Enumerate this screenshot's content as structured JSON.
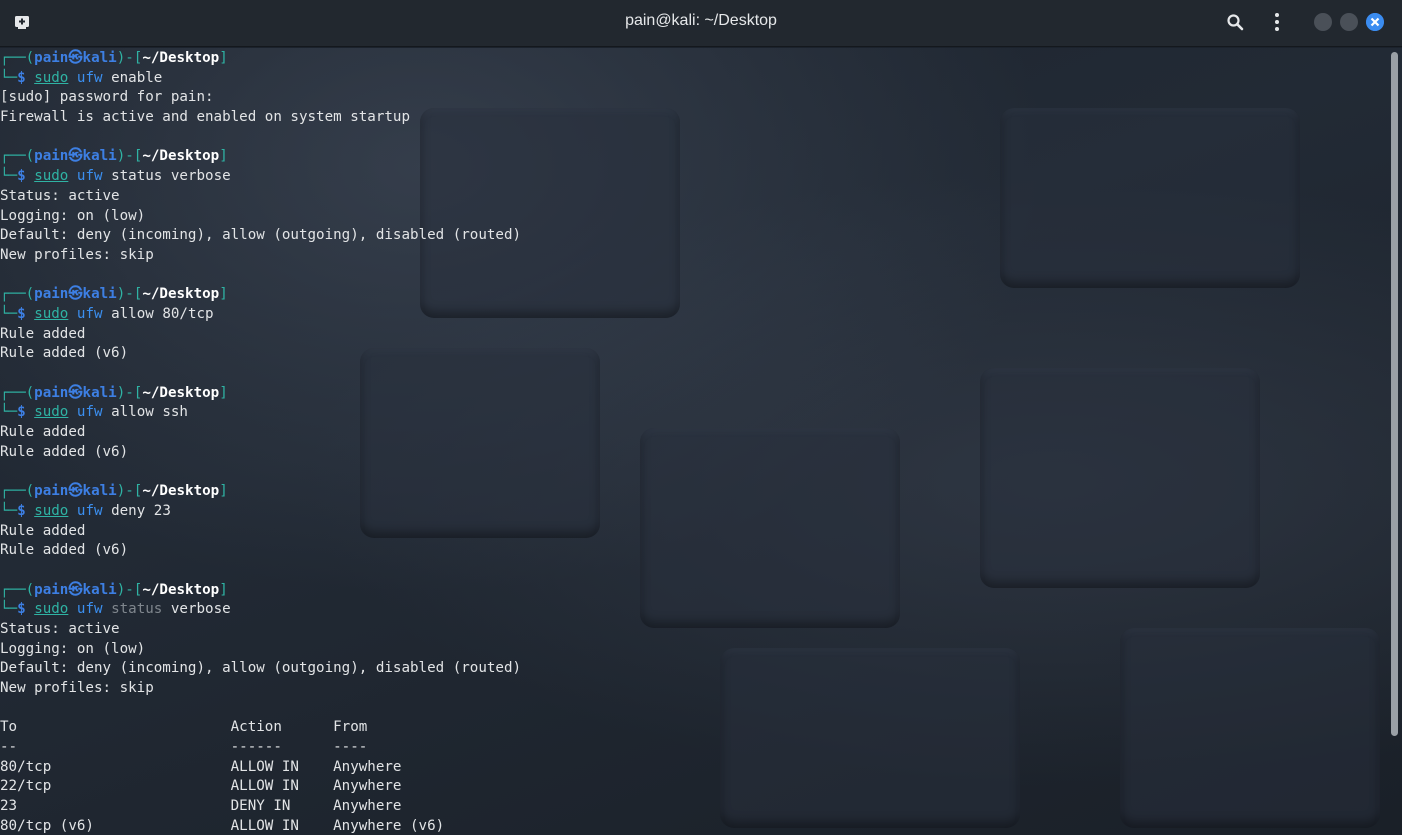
{
  "window": {
    "title": "pain@kali: ~/Desktop"
  },
  "prompt": {
    "user": "pain",
    "host": "kali",
    "cwd": "~/Desktop",
    "symbol": "$"
  },
  "blocks": [
    {
      "sudo": "sudo",
      "ufw": "ufw",
      "args": "enable",
      "output": [
        "[sudo] password for pain:",
        "Firewall is active and enabled on system startup"
      ]
    },
    {
      "sudo": "sudo",
      "ufw": "ufw",
      "args": "status verbose",
      "output": [
        "Status: active",
        "Logging: on (low)",
        "Default: deny (incoming), allow (outgoing), disabled (routed)",
        "New profiles: skip"
      ]
    },
    {
      "sudo": "sudo",
      "ufw": "ufw",
      "args": "allow 80/tcp",
      "output": [
        "Rule added",
        "Rule added (v6)"
      ]
    },
    {
      "sudo": "sudo",
      "ufw": "ufw",
      "args": "allow ssh",
      "output": [
        "Rule added",
        "Rule added (v6)"
      ]
    },
    {
      "sudo": "sudo",
      "ufw": "ufw",
      "args": "deny 23",
      "output": [
        "Rule added",
        "Rule added (v6)"
      ]
    },
    {
      "sudo": "sudo",
      "ufw": "ufw",
      "args_dim": "status",
      "args": "verbose",
      "output": [
        "Status: active",
        "Logging: on (low)",
        "Default: deny (incoming), allow (outgoing), disabled (routed)",
        "New profiles: skip"
      ]
    }
  ],
  "table": {
    "header": "To                         Action      From",
    "divider": "--                         ------      ----",
    "rows": [
      "80/tcp                     ALLOW IN    Anywhere",
      "22/tcp                     ALLOW IN    Anywhere",
      "23                         DENY IN     Anywhere",
      "80/tcp (v6)                ALLOW IN    Anywhere (v6)"
    ]
  },
  "icons": {
    "new_tab": "new-tab-icon",
    "search": "search-icon",
    "menu": "kebab-menu-icon",
    "close": "close-icon"
  },
  "colors": {
    "accent": "#3b8cf0",
    "prompt_green": "#2fb3a4",
    "prompt_blue": "#3d7fe3"
  }
}
